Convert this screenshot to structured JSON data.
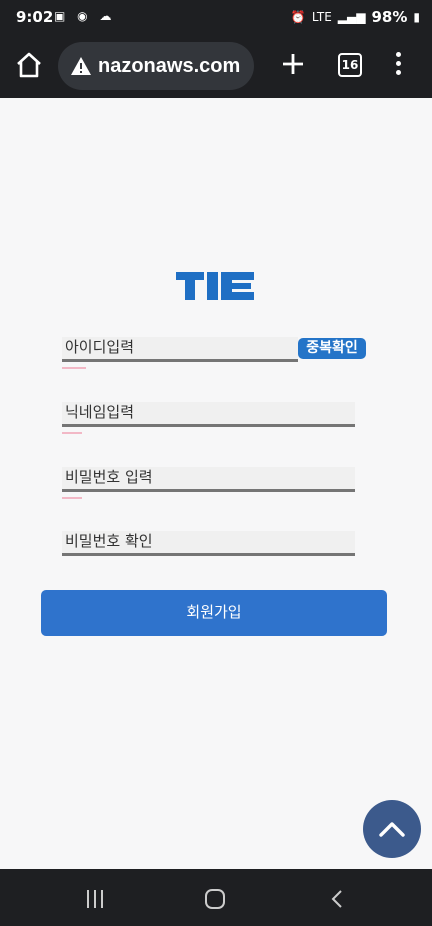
{
  "status_bar": {
    "time": "9:02",
    "battery": "98%",
    "network": "LTE"
  },
  "browser": {
    "url": "nazonaws.com",
    "tab_count": "16"
  },
  "form": {
    "id_placeholder": "아이디입력",
    "duplicate_check_label": "중복확인",
    "nickname_placeholder": "닉네임입력",
    "password_placeholder": "비밀번호 입력",
    "password_confirm_placeholder": "비밀번호 확인",
    "signup_label": "회원가입"
  },
  "colors": {
    "primary": "#2f73cc",
    "logo": "#1f6fc4",
    "scroll_top": "#3c5a8c"
  },
  "icons": [
    "home-icon",
    "warning-icon",
    "plus-icon",
    "tabs-icon",
    "menu-icon",
    "chevron-up-icon",
    "recent-apps-icon",
    "nav-home-icon",
    "back-icon"
  ]
}
